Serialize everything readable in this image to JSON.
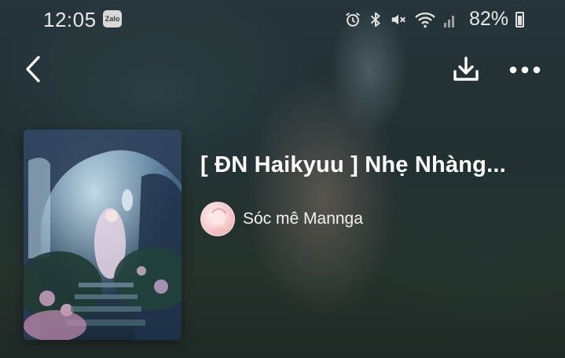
{
  "status_bar": {
    "time": "12:05",
    "notification_badge": "Zalo",
    "battery_percent": "82%",
    "icons": [
      "alarm-icon",
      "bluetooth-icon",
      "mute-icon",
      "wifi-icon",
      "signal-icon",
      "battery-icon"
    ]
  },
  "nav": {
    "icons": [
      "back-arrow-icon",
      "download-icon",
      "more-options-icon"
    ]
  },
  "book": {
    "title": "[ ĐN Haikyuu ] Nhẹ Nhàng...",
    "author": "Sóc mê Mannga"
  },
  "colors": {
    "background": "#26373a",
    "text": "#ffffff"
  }
}
